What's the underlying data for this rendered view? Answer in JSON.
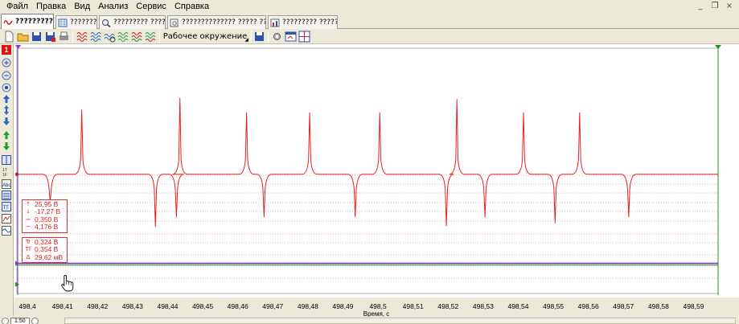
{
  "menu": [
    {
      "label": "Файл"
    },
    {
      "label": "Правка"
    },
    {
      "label": "Вид"
    },
    {
      "label": "Анализ"
    },
    {
      "label": "Сервис"
    },
    {
      "label": "Справка"
    }
  ],
  "window_controls": {
    "minimize": "_",
    "restore": "❐",
    "close": "×"
  },
  "tabs": [
    {
      "label": "???????????",
      "active": true
    },
    {
      "label": "?????????"
    },
    {
      "label": "????????? ?????????"
    },
    {
      "label": "?????????????? ????? ?????????"
    },
    {
      "label": "????????? ??????????"
    }
  ],
  "toolbar": {
    "workspace_label": "Рабочее окружение"
  },
  "channel_badge": "1",
  "colors": {
    "signal": "#e82020",
    "channel2": "#7a2fd0",
    "channel3": "#20a020",
    "grid": "#e89898",
    "cursor_left": "#7a3fc0",
    "cursor_right": "#209020"
  },
  "measure_box_1": {
    "rows": [
      {
        "icon": "max-arrow-icon",
        "key": "⭡",
        "value": "25,95 В"
      },
      {
        "icon": "min-arrow-icon",
        "key": "⭣",
        "value": "-17,27 В"
      },
      {
        "icon": "mean-icon",
        "key": "⎓",
        "value": "0,350 В"
      },
      {
        "icon": "rms-icon",
        "key": "~",
        "value": "4,176 В"
      }
    ]
  },
  "measure_box_2": {
    "rows": [
      {
        "icon": "rise-time-icon",
        "key": "Tr",
        "value": "0,324 В"
      },
      {
        "icon": "fall-time-icon",
        "key": "Tf",
        "value": "0,354 В"
      },
      {
        "icon": "delta-icon",
        "key": "Δ",
        "value": "29,62 мВ"
      }
    ]
  },
  "x_axis": {
    "label": "Время, с",
    "ticks": [
      "498,4",
      "498,41",
      "498,42",
      "498,43",
      "498,44",
      "498,45",
      "498,46",
      "498,47",
      "498,48",
      "498,49",
      "498,5",
      "498,51",
      "498,52",
      "498,53",
      "498,54",
      "498,55",
      "498,56",
      "498,57",
      "498,58",
      "498,59"
    ]
  },
  "status": {
    "zoom": "1:50"
  },
  "chart_data": {
    "type": "line",
    "xlabel": "Время, с",
    "xlim": [
      498.397,
      498.597
    ],
    "series": [
      {
        "color": "#e82020",
        "baseline": 0.35,
        "positive_spikes_x": [
          498.4155,
          498.4435,
          498.4625,
          498.4805,
          498.5005,
          498.5225,
          498.5415,
          498.5575
        ],
        "positive_spike_heights": [
          22,
          25.95,
          21,
          21,
          21,
          25.5,
          21,
          21
        ],
        "negative_spikes_x": [
          498.4065,
          498.4365,
          498.4425,
          498.4675,
          498.4935,
          498.5195,
          498.5305,
          498.5505,
          498.5715
        ],
        "negative_spike_depths": [
          -9,
          -17.27,
          -14,
          -14,
          -14,
          -17,
          -14,
          -16,
          -14
        ]
      },
      {
        "color": "#7a2fd0",
        "constant": -29.62
      },
      {
        "color": "#20a020",
        "constant": -30.2
      }
    ]
  }
}
